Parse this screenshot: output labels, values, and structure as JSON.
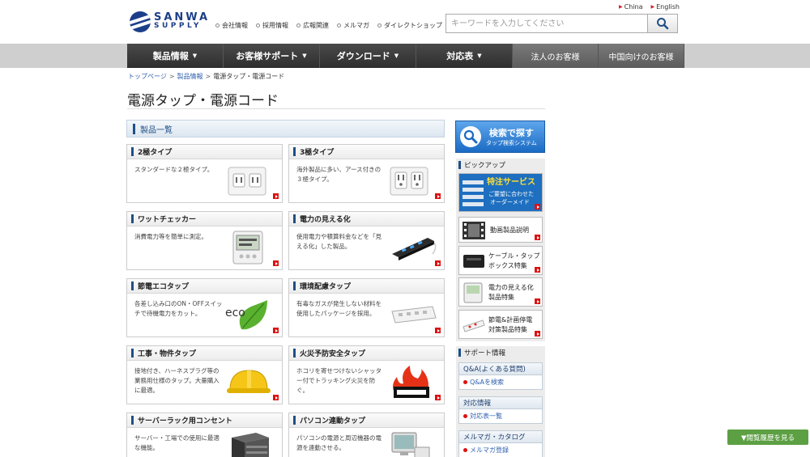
{
  "header": {
    "logo_line1": "SANWA",
    "logo_line2": "SUPPLY",
    "top_links": [
      "会社情報",
      "採用情報",
      "広報関連",
      "メルマガ",
      "ダイレクトショップ"
    ],
    "lang_links": [
      "China",
      "English"
    ],
    "search_placeholder": "キーワードを入力してください"
  },
  "nav": {
    "items": [
      "製品情報",
      "お客様サポート",
      "ダウンロード",
      "対応表",
      "法人のお客様",
      "中国向けのお客様"
    ]
  },
  "breadcrumb": [
    "トップページ",
    "製品情報",
    "電源タップ・電源コード"
  ],
  "page_title": "電源タップ・電源コード",
  "list_heading": "製品一覧",
  "products": [
    {
      "name": "2極タイプ",
      "desc": "スタンダードな２極タイプ。"
    },
    {
      "name": "3極タイプ",
      "desc": "海外製品に多い、アース付きの３極タイプ。"
    },
    {
      "name": "ワットチェッカー",
      "desc": "消費電力等を簡単に測定。"
    },
    {
      "name": "電力の見える化",
      "desc": "使用電力や積算料金などを「見える化」した製品。"
    },
    {
      "name": "節電エコタップ",
      "desc": "各差し込み口のON・OFFスイッチで待機電力をカット。"
    },
    {
      "name": "環境配慮タップ",
      "desc": "有毒なガスが発生しない材料を使用したパッケージを採用。"
    },
    {
      "name": "工事・物件タップ",
      "desc": "接地付き、ハーネスプラグ等の業務用仕様のタップ。大量購入に最適。"
    },
    {
      "name": "火災予防安全タップ",
      "desc": "ホコリを寄せつけないシャッター付でトラッキング火災を防ぐ。"
    },
    {
      "name": "サーバーラック用コンセント",
      "desc": "サーバー・工場での使用に最適な機能。"
    },
    {
      "name": "パソコン連動タップ",
      "desc": "パソコンの電源と周辺機器の電源を連動させる。"
    }
  ],
  "sidebar": {
    "search_title": "検索で探す",
    "search_sub": "タップ検索システム",
    "pickup_title": "ピックアップ",
    "pickups": [
      {
        "label1": "特注サービス",
        "label2": "ご要望に合わせた",
        "label3": "オーダーメイド"
      },
      {
        "label1": "動画製品説明"
      },
      {
        "label1": "ケーブル・タップ",
        "label2": "ボックス特集"
      },
      {
        "label1": "電力の見える化",
        "label2": "製品特集"
      },
      {
        "label1": "節電&計画停電",
        "label2": "対策製品特集"
      }
    ],
    "support_title": "サポート情報",
    "support": [
      {
        "head": "Q&A(よくある質問)",
        "link": "Q&Aを検索"
      },
      {
        "head": "対応情報",
        "link": "対応表一覧"
      },
      {
        "head": "メルマガ・カタログ",
        "link": "メルマガ登録"
      }
    ]
  },
  "history_button": "▼閲覧履歴を見る",
  "colors": {
    "brand": "#1d3f8a",
    "nav_dark": "#3a3a3a",
    "accent_red": "#dd1111",
    "history_green": "#5da044"
  }
}
